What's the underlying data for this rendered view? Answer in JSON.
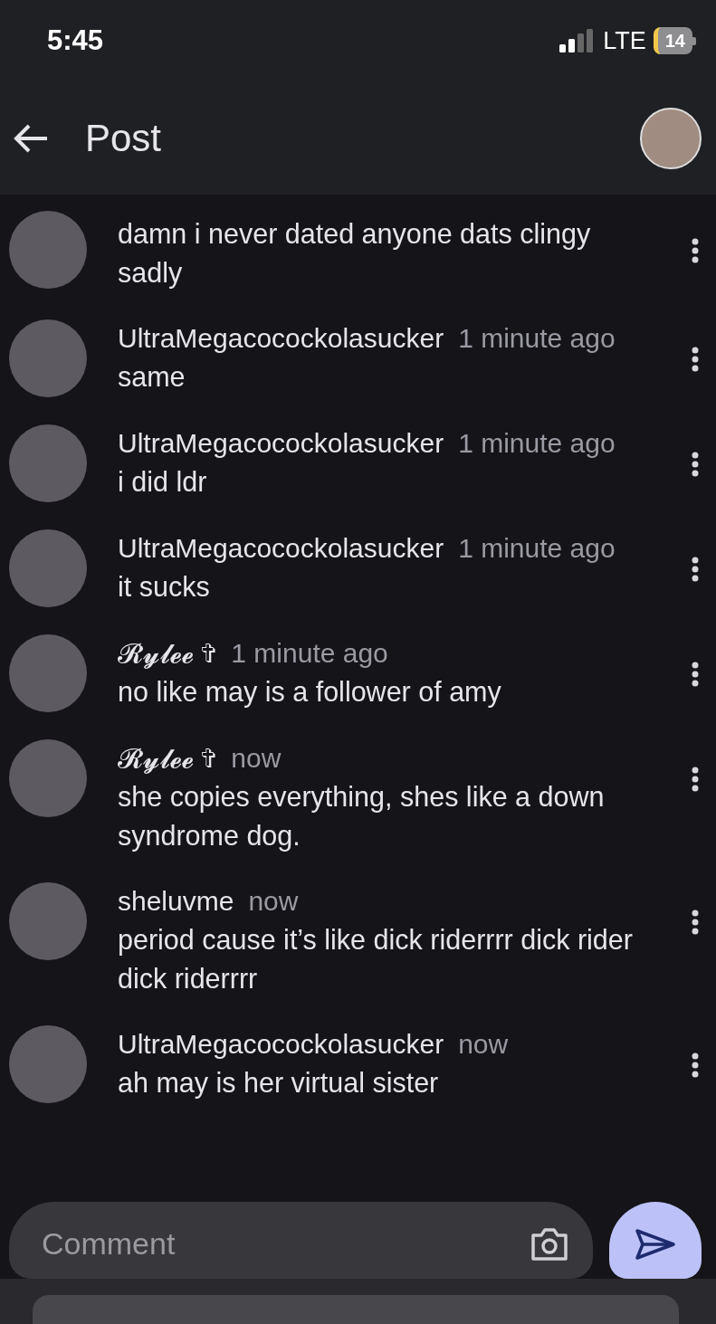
{
  "status_bar": {
    "time": "5:45",
    "network": "LTE",
    "battery": "14"
  },
  "header": {
    "title": "Post"
  },
  "comments": [
    {
      "text": "damn i never dated anyone dats clingy sadly"
    },
    {
      "author": "UltraMegacocockolasucker",
      "time": "1 minute ago",
      "text": "same"
    },
    {
      "author": "UltraMegacocockolasucker",
      "time": "1 minute ago",
      "text": "i did ldr"
    },
    {
      "author": "UltraMegacocockolasucker",
      "time": "1 minute ago",
      "text": "it sucks"
    },
    {
      "author": "𝓡𝔂𝓵𝓮𝓮 ✞",
      "time": "1 minute ago",
      "text": "no like may is a follower of amy"
    },
    {
      "author": "𝓡𝔂𝓵𝓮𝓮 ✞",
      "time": "now",
      "text": "she copies everything, shes like a down syndrome dog."
    },
    {
      "author": "sheluvme",
      "time": "now",
      "text": "period cause it’s like dick riderrrr dick rider dick riderrrr"
    },
    {
      "author": "UltraMegacocockolasucker",
      "time": "now",
      "text": "ah may is her virtual sister"
    }
  ],
  "composer": {
    "placeholder": "Comment"
  }
}
